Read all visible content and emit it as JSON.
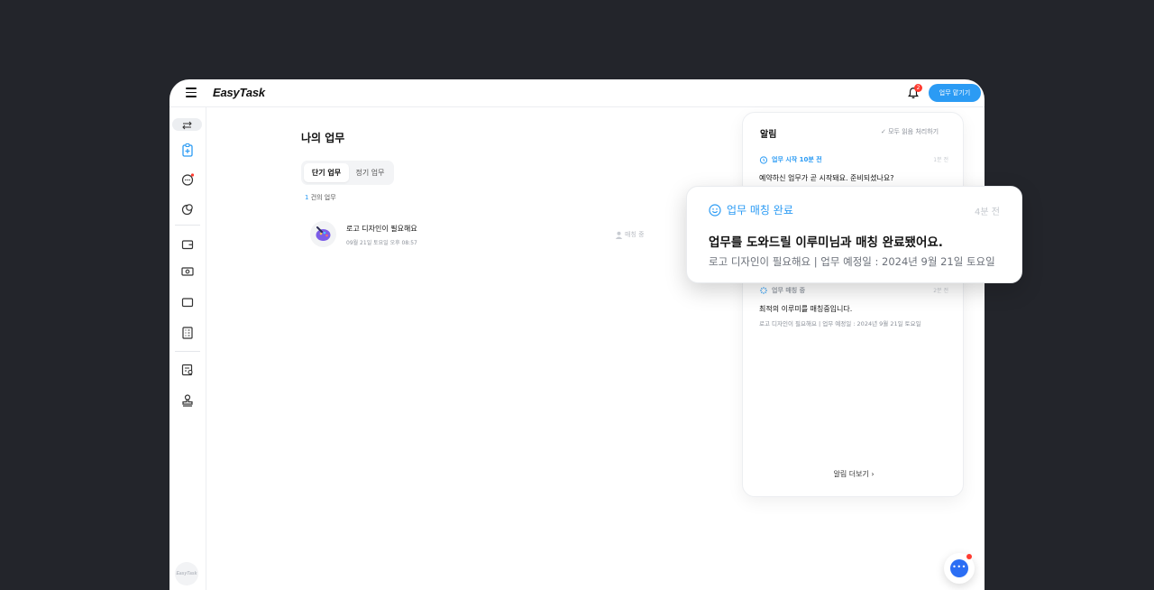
{
  "app": {
    "logo": "EasyTask",
    "notification_count": "2",
    "request_button": "업무 맡기기",
    "sidebar_logo": "EasyTask"
  },
  "main": {
    "title": "나의 업무",
    "tabs": [
      {
        "label": "단기 업무",
        "active": true
      },
      {
        "label": "정기 업무",
        "active": false
      }
    ],
    "count_number": "1",
    "count_text": " 건의 업무",
    "tasks": [
      {
        "title": "로고 디자인이 필요해요",
        "date": "09월 21일 토요일 오후 08:57",
        "status": "매칭 중"
      }
    ]
  },
  "notifications": {
    "title": "알림",
    "read_all": "모두 읽음 처리하기",
    "items": [
      {
        "type": "업무 시작 10분 전",
        "time": "1분 전",
        "message": "예약하신 업무가 곧 시작돼요. 준비되셨나요?"
      },
      {
        "type": "업무 매칭 중",
        "time": "2분 전",
        "message": "최적의 이루미를 매칭중입니다.",
        "sub": "로고 디자인이 필요해요 | 업무 예정일 : 2024년 9월 21일 토요일"
      }
    ],
    "more": "알림 더보기"
  },
  "toast": {
    "type": "업무 매칭 완료",
    "time": "4분 전",
    "message": "업무를 도와드릴 이루미님과 매칭 완료됐어요.",
    "sub": "로고 디자인이 필요해요 | 업무 예정일 : 2024년 9월 21일 토요일"
  },
  "colors": {
    "accent": "#2b9bf4",
    "background": "#23252b",
    "badge": "#ff3b30",
    "chat": "#2b6ef4"
  },
  "icons": [
    "menu-icon",
    "bell-icon",
    "switch-icon",
    "task-clipboard-icon",
    "chat-bubble-icon",
    "coin-icon",
    "wallet-icon",
    "cash-icon",
    "card-icon",
    "receipt-icon",
    "certificate-icon",
    "stamp-icon",
    "alarm-icon",
    "smile-icon",
    "loading-icon",
    "chevron-right-icon",
    "check-icon",
    "person-icon"
  ]
}
